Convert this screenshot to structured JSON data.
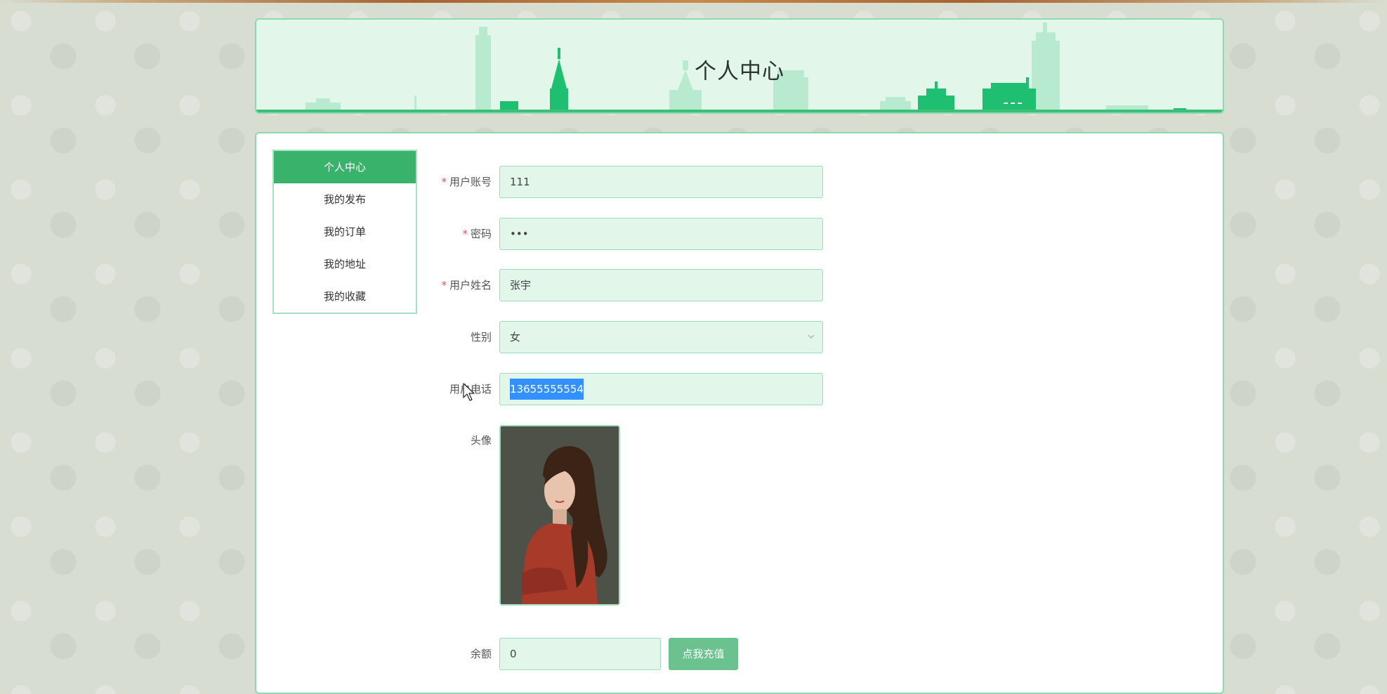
{
  "header": {
    "title": "个人中心"
  },
  "sidebar": {
    "items": [
      {
        "label": "个人中心",
        "active": true
      },
      {
        "label": "我的发布",
        "active": false
      },
      {
        "label": "我的订单",
        "active": false
      },
      {
        "label": "我的地址",
        "active": false
      },
      {
        "label": "我的收藏",
        "active": false
      }
    ]
  },
  "form": {
    "account": {
      "required_mark": "*",
      "label": "用户账号",
      "value": "111"
    },
    "password": {
      "required_mark": "*",
      "label": "密码",
      "value": "•••"
    },
    "name": {
      "required_mark": "*",
      "label": "用户姓名",
      "value": "张宇"
    },
    "gender": {
      "label": "性别",
      "value": "女"
    },
    "phone": {
      "label": "用户电话",
      "value": "13655555554"
    },
    "avatar": {
      "label": "头像"
    },
    "balance": {
      "label": "余额",
      "value": "0",
      "button_label": "点我充值"
    }
  },
  "colors": {
    "accent": "#39b36c",
    "button": "#6cc28e",
    "input_bg": "#e3f6ea",
    "border": "#9fdcbc",
    "required": "#e15759",
    "selection": "#3390ff"
  }
}
